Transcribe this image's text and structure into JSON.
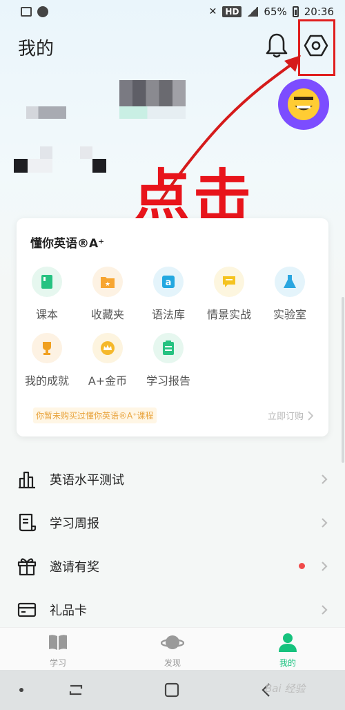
{
  "status_bar": {
    "network": "HD",
    "battery": "65%",
    "time": "20:36"
  },
  "header": {
    "title": "我的"
  },
  "annotation": {
    "text": "点击"
  },
  "card": {
    "title": "懂你英语®A⁺",
    "items": [
      {
        "label": "课本",
        "icon": "book-icon",
        "color": "#26c281",
        "bg": "#e6f7ef"
      },
      {
        "label": "收藏夹",
        "icon": "star-folder-icon",
        "color": "#f7a531",
        "bg": "#fdf2e3"
      },
      {
        "label": "语法库",
        "icon": "grammar-a-icon",
        "color": "#23a8e0",
        "bg": "#e4f4fb"
      },
      {
        "label": "情景实战",
        "icon": "chat-bubble-icon",
        "color": "#f5c31f",
        "bg": "#fdf6df"
      },
      {
        "label": "实验室",
        "icon": "flask-icon",
        "color": "#2aa6e0",
        "bg": "#e4f4fb"
      },
      {
        "label": "我的成就",
        "icon": "trophy-icon",
        "color": "#f0a020",
        "bg": "#fdf2e3"
      },
      {
        "label": "A+金币",
        "icon": "crown-coin-icon",
        "color": "#f5b82b",
        "bg": "#fdf4df"
      },
      {
        "label": "学习报告",
        "icon": "report-icon",
        "color": "#26c281",
        "bg": "#e6f7ef"
      }
    ],
    "notice": "你暂未购买过懂你英语®A⁺课程",
    "subscribe": "立即订购"
  },
  "menu": [
    {
      "label": "英语水平测试",
      "icon": "bar-chart-icon"
    },
    {
      "label": "学习周报",
      "icon": "scroll-icon"
    },
    {
      "label": "邀请有奖",
      "icon": "gift-icon",
      "badge": true
    },
    {
      "label": "礼品卡",
      "icon": "card-icon"
    }
  ],
  "tabs": [
    {
      "label": "学习",
      "icon": "book-open-icon",
      "active": false
    },
    {
      "label": "发现",
      "icon": "planet-icon",
      "active": false
    },
    {
      "label": "我的",
      "icon": "person-icon",
      "active": true
    }
  ],
  "watermark": "Bai 经验",
  "colors": {
    "accent": "#16c27d",
    "annotation": "#e8141b",
    "avatar_bg": "#7c4dff"
  }
}
